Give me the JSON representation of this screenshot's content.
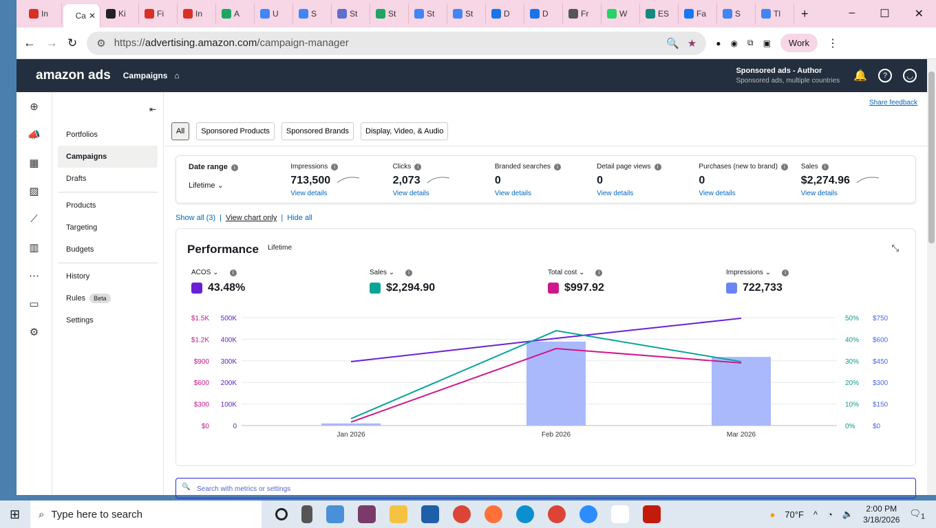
{
  "browser": {
    "tabs": [
      {
        "label": "In",
        "color": "#d93025"
      },
      {
        "label": "Ca",
        "color": "#fff",
        "active": true
      },
      {
        "label": "Ki",
        "color": "#222"
      },
      {
        "label": "Fi",
        "color": "#d93025"
      },
      {
        "label": "In",
        "color": "#d93025"
      },
      {
        "label": "A",
        "color": "#1fa463"
      },
      {
        "label": "U",
        "color": "#4285f4"
      },
      {
        "label": "S",
        "color": "#4285f4"
      },
      {
        "label": "St",
        "color": "#5f6ecd"
      },
      {
        "label": "St",
        "color": "#1fa463"
      },
      {
        "label": "St",
        "color": "#4285f4"
      },
      {
        "label": "St",
        "color": "#4285f4"
      },
      {
        "label": "D",
        "color": "#1a73e8"
      },
      {
        "label": "D",
        "color": "#1a73e8"
      },
      {
        "label": "Fr",
        "color": "#555"
      },
      {
        "label": "W",
        "color": "#25d366"
      },
      {
        "label": "ES",
        "color": "#138a7d"
      },
      {
        "label": "Fa",
        "color": "#1877f2"
      },
      {
        "label": "S",
        "color": "#4285f4"
      },
      {
        "label": "Tl",
        "color": "#4285f4"
      }
    ],
    "url_prefix": "https://",
    "url_host": "advertising.amazon.com",
    "url_path": "/campaign-manager",
    "profile": "Work"
  },
  "header": {
    "logo": "amazon ads",
    "nav": "Campaigns",
    "account_title": "Sponsored ads - Author",
    "account_sub": "Sponsored ads, multiple countries"
  },
  "sidebar": {
    "items": [
      {
        "label": "Portfolios"
      },
      {
        "label": "Campaigns",
        "active": true
      },
      {
        "label": "Drafts"
      },
      {
        "label": "Products"
      },
      {
        "label": "Targeting"
      },
      {
        "label": "Budgets"
      },
      {
        "label": "History"
      },
      {
        "label": "Rules",
        "badge": "Beta"
      },
      {
        "label": "Settings"
      }
    ]
  },
  "main": {
    "share_feedback": "Share feedback",
    "filters": [
      "All",
      "Sponsored Products",
      "Sponsored Brands",
      "Display, Video, & Audio"
    ],
    "date_range": {
      "label": "Date range",
      "value": "Lifetime"
    },
    "metrics": [
      {
        "label": "Impressions",
        "value": "713,500",
        "link": "View details",
        "spark": true
      },
      {
        "label": "Clicks",
        "value": "2,073",
        "link": "View details",
        "spark": true
      },
      {
        "label": "Branded searches",
        "value": "0",
        "link": "View details"
      },
      {
        "label": "Detail page views",
        "value": "0",
        "link": "View details"
      },
      {
        "label": "Purchases (new to brand)",
        "value": "0",
        "link": "View details"
      },
      {
        "label": "Sales",
        "value": "$2,274.96",
        "link": "View details",
        "spark": true
      }
    ],
    "links": {
      "show_all": "Show all (3)",
      "view_chart": "View chart only",
      "hide_all": "Hide all"
    },
    "performance": {
      "title": "Performance",
      "subtitle": "Lifetime",
      "selectors": [
        {
          "label": "ACOS",
          "value": "43.48%",
          "color": "#6a1fd8"
        },
        {
          "label": "Sales",
          "value": "$2,294.90",
          "color": "#0aa39a"
        },
        {
          "label": "Total cost",
          "value": "$997.92",
          "color": "#d0168c"
        },
        {
          "label": "Impressions",
          "value": "722,733",
          "color": "#6b84f5"
        }
      ]
    },
    "search_placeholder": "Search with metrics or settings"
  },
  "chart_data": {
    "type": "bar+line",
    "categories": [
      "Jan 2026",
      "Feb 2026",
      "Mar 2026"
    ],
    "axes": {
      "left_cost": {
        "ticks": [
          "$0",
          "$300",
          "$600",
          "$900",
          "$1.2K",
          "$1.5K"
        ],
        "range": [
          0,
          1500
        ],
        "color": "#c2188a"
      },
      "left_impr": {
        "ticks": [
          "0",
          "100K",
          "200K",
          "300K",
          "400K",
          "500K"
        ],
        "range": [
          0,
          500000
        ],
        "color": "#5a1fc8"
      },
      "right_pct": {
        "ticks": [
          "0%",
          "10%",
          "20%",
          "30%",
          "40%",
          "50%"
        ],
        "range": [
          0,
          50
        ],
        "color": "#0a9a90"
      },
      "right_usd": {
        "ticks": [
          "$0",
          "$150",
          "$300",
          "$450",
          "$600",
          "$750"
        ],
        "range": [
          0,
          750
        ],
        "color": "#4a66e0"
      }
    },
    "series": [
      {
        "name": "Impressions",
        "kind": "bar",
        "axis": "left_impr",
        "values": [
          10000,
          389000,
          318000
        ],
        "color": "#a9b9fb"
      },
      {
        "name": "ACOS",
        "kind": "line",
        "axis": "right_pct",
        "values": [
          29.6,
          40.4,
          49.7
        ],
        "color": "#6a1fd8"
      },
      {
        "name": "Sales",
        "kind": "line",
        "axis": "left_cost",
        "values": [
          96,
          1318,
          888
        ],
        "color": "#0aa39a"
      },
      {
        "name": "Total cost",
        "kind": "line",
        "axis": "right_usd",
        "values": [
          24,
          535,
          435
        ],
        "color": "#d0168c"
      }
    ],
    "grid": true
  },
  "taskbar": {
    "search": "Type here to search",
    "weather": "70°F",
    "time": "2:00 PM",
    "date": "3/18/2026",
    "notifications": "1"
  }
}
